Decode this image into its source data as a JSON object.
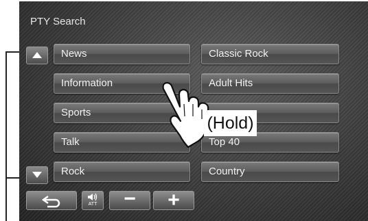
{
  "header": {
    "title": "PTY Search"
  },
  "list": {
    "left": [
      "News",
      "Information",
      "Sports",
      "Talk",
      "Rock"
    ],
    "right": [
      "Classic Rock",
      "Adult Hits",
      "",
      "Top 40",
      "Country"
    ]
  },
  "bottom_bar": {
    "att_label": "ATT",
    "minus_label": "−",
    "plus_label": "+"
  },
  "annotation": {
    "hold_label": "(Hold)"
  },
  "colors": {
    "background": "#3a3a3a",
    "button": "#5d5d5d",
    "text": "#f2f2f2"
  }
}
